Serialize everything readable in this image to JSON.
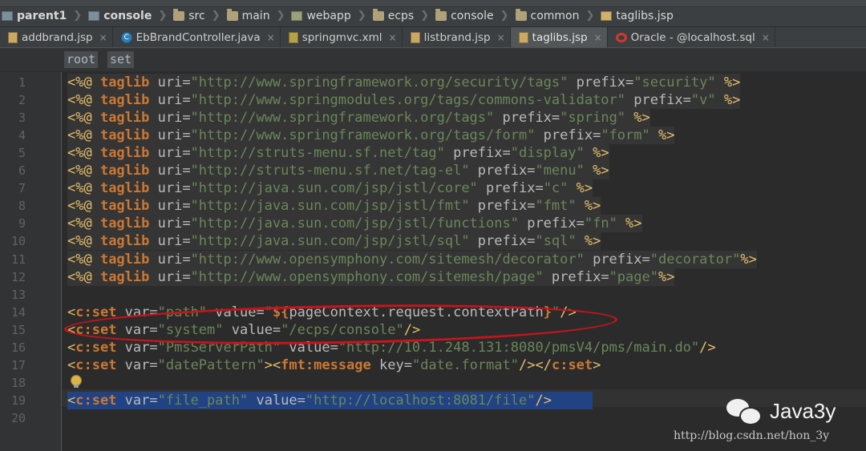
{
  "breadcrumbs": [
    {
      "label": "parent1",
      "icon": "module-icon"
    },
    {
      "label": "console",
      "icon": "module-icon"
    },
    {
      "label": "src",
      "icon": "folder-icon"
    },
    {
      "label": "main",
      "icon": "folder-icon"
    },
    {
      "label": "webapp",
      "icon": "webapp-folder-icon"
    },
    {
      "label": "ecps",
      "icon": "folder-icon"
    },
    {
      "label": "console",
      "icon": "folder-icon"
    },
    {
      "label": "common",
      "icon": "folder-icon"
    },
    {
      "label": "taglibs.jsp",
      "icon": "jsp-file-icon"
    }
  ],
  "tabs": [
    {
      "label": "addbrand.jsp",
      "icon": "jsp-file-icon",
      "close": "×"
    },
    {
      "label": "EbBrandController.java",
      "icon": "java-class-icon",
      "close": "×"
    },
    {
      "label": "springmvc.xml",
      "icon": "xml-file-icon",
      "close": "×"
    },
    {
      "label": "listbrand.jsp",
      "icon": "jsp-file-icon",
      "close": "×"
    },
    {
      "label": "taglibs.jsp",
      "icon": "jsp-file-icon",
      "close": "×",
      "active": true
    },
    {
      "label": "Oracle - @localhost.sql",
      "icon": "oracle-sql-icon",
      "close": "×"
    }
  ],
  "tag_path": [
    "root",
    "set"
  ],
  "lines": [
    {
      "num": "1",
      "tokens": [
        [
          "d",
          "<%@ "
        ],
        [
          "k",
          "taglib"
        ],
        [
          "a",
          " uri="
        ],
        [
          "v",
          "\"http://www.springframework.org/security/tags\""
        ],
        [
          "a",
          " prefix="
        ],
        [
          "v",
          "\"security\""
        ],
        [
          "d",
          " %>"
        ]
      ]
    },
    {
      "num": "2",
      "tokens": [
        [
          "d",
          "<%@ "
        ],
        [
          "k",
          "taglib"
        ],
        [
          "a",
          " uri="
        ],
        [
          "v",
          "\"http://www.springmodules.org/tags/commons-validator\""
        ],
        [
          "a",
          " prefix="
        ],
        [
          "v",
          "\"v\""
        ],
        [
          "d",
          " %>"
        ]
      ]
    },
    {
      "num": "3",
      "tokens": [
        [
          "d",
          "<%@ "
        ],
        [
          "k",
          "taglib"
        ],
        [
          "a",
          " uri="
        ],
        [
          "v",
          "\"http://www.springframework.org/tags\""
        ],
        [
          "a",
          " prefix="
        ],
        [
          "v",
          "\"spring\""
        ],
        [
          "d",
          " %>"
        ]
      ]
    },
    {
      "num": "4",
      "tokens": [
        [
          "d",
          "<%@ "
        ],
        [
          "k",
          "taglib"
        ],
        [
          "a",
          " uri="
        ],
        [
          "v",
          "\"http://www.springframework.org/tags/form\""
        ],
        [
          "a",
          " prefix="
        ],
        [
          "v",
          "\"form\""
        ],
        [
          "d",
          " %>"
        ]
      ]
    },
    {
      "num": "5",
      "tokens": [
        [
          "d",
          "<%@ "
        ],
        [
          "k",
          "taglib"
        ],
        [
          "a",
          " uri="
        ],
        [
          "v",
          "\"http://struts-menu.sf.net/tag\""
        ],
        [
          "a",
          " prefix="
        ],
        [
          "v",
          "\"display\""
        ],
        [
          "d",
          " %>"
        ]
      ]
    },
    {
      "num": "6",
      "tokens": [
        [
          "d",
          "<%@ "
        ],
        [
          "k",
          "taglib"
        ],
        [
          "a",
          " uri="
        ],
        [
          "v",
          "\"http://struts-menu.sf.net/tag-el\""
        ],
        [
          "a",
          " prefix="
        ],
        [
          "v",
          "\"menu\""
        ],
        [
          "d",
          " %>"
        ]
      ]
    },
    {
      "num": "7",
      "tokens": [
        [
          "d",
          "<%@ "
        ],
        [
          "k",
          "taglib"
        ],
        [
          "a",
          " uri="
        ],
        [
          "v",
          "\"http://java.sun.com/jsp/jstl/core\""
        ],
        [
          "a",
          " prefix="
        ],
        [
          "v",
          "\"c\""
        ],
        [
          "d",
          " %>"
        ]
      ]
    },
    {
      "num": "8",
      "tokens": [
        [
          "d",
          "<%@ "
        ],
        [
          "k",
          "taglib"
        ],
        [
          "a",
          " uri="
        ],
        [
          "v",
          "\"http://java.sun.com/jsp/jstl/fmt\""
        ],
        [
          "a",
          " prefix="
        ],
        [
          "v",
          "\"fmt\""
        ],
        [
          "d",
          " %>"
        ]
      ]
    },
    {
      "num": "9",
      "tokens": [
        [
          "d",
          "<%@ "
        ],
        [
          "k",
          "taglib"
        ],
        [
          "a",
          " uri="
        ],
        [
          "v",
          "\"http://java.sun.com/jsp/jstl/functions\""
        ],
        [
          "a",
          " prefix="
        ],
        [
          "v",
          "\"fn\""
        ],
        [
          "d",
          " %>"
        ]
      ]
    },
    {
      "num": "10",
      "tokens": [
        [
          "d",
          "<%@ "
        ],
        [
          "k",
          "taglib"
        ],
        [
          "a",
          " uri="
        ],
        [
          "v",
          "\"http://java.sun.com/jsp/jstl/sql\""
        ],
        [
          "a",
          " prefix="
        ],
        [
          "v",
          "\"sql\""
        ],
        [
          "d",
          " %>"
        ]
      ]
    },
    {
      "num": "11",
      "tokens": [
        [
          "d",
          "<%@ "
        ],
        [
          "k",
          "taglib"
        ],
        [
          "a",
          " uri="
        ],
        [
          "v",
          "\"http://www.opensymphony.com/sitemesh/decorator\""
        ],
        [
          "a",
          " prefix="
        ],
        [
          "v",
          "\"decorator\""
        ],
        [
          "d",
          "%>"
        ]
      ]
    },
    {
      "num": "12",
      "tokens": [
        [
          "d",
          "<%@ "
        ],
        [
          "k",
          "taglib"
        ],
        [
          "a",
          " uri="
        ],
        [
          "v",
          "\"http://www.opensymphony.com/sitemesh/page\""
        ],
        [
          "a",
          " prefix="
        ],
        [
          "v",
          "\"page\""
        ],
        [
          "d",
          "%>"
        ]
      ]
    },
    {
      "num": "13",
      "tokens": []
    },
    {
      "num": "14",
      "tokens": [
        [
          "t",
          "<"
        ],
        [
          "k",
          "c:set"
        ],
        [
          "a",
          " var="
        ],
        [
          "v",
          "\"path\""
        ],
        [
          "a",
          " value="
        ],
        [
          "v",
          "\""
        ],
        [
          "e",
          "${"
        ],
        [
          "a",
          "pageContext.request.contextPath"
        ],
        [
          "e",
          "}"
        ],
        [
          "v",
          "\""
        ],
        [
          "t",
          "/>"
        ]
      ]
    },
    {
      "num": "15",
      "tokens": [
        [
          "t",
          "<"
        ],
        [
          "k",
          "c:set"
        ],
        [
          "a",
          " var="
        ],
        [
          "v",
          "\"system\""
        ],
        [
          "a",
          " value="
        ],
        [
          "v",
          "\"/ecps/console\""
        ],
        [
          "t",
          "/>"
        ]
      ]
    },
    {
      "num": "16",
      "tokens": [
        [
          "t",
          "<"
        ],
        [
          "k",
          "c:set"
        ],
        [
          "a",
          " var="
        ],
        [
          "v",
          "\"PmsServerPath\""
        ],
        [
          "a",
          " value="
        ],
        [
          "v",
          "\"http://10.1.248.131:8080/pmsV4/pms/main.do\""
        ],
        [
          "t",
          "/>"
        ]
      ]
    },
    {
      "num": "17",
      "tokens": [
        [
          "t",
          "<"
        ],
        [
          "k",
          "c:set"
        ],
        [
          "a",
          " var="
        ],
        [
          "v",
          "\"datePattern\""
        ],
        [
          "t",
          "><"
        ],
        [
          "k",
          "fmt:message"
        ],
        [
          "a",
          " key="
        ],
        [
          "v",
          "\"date.format\""
        ],
        [
          "t",
          "/></"
        ],
        [
          "k",
          "c:set"
        ],
        [
          "t",
          ">"
        ]
      ]
    },
    {
      "num": "18",
      "tokens": []
    },
    {
      "num": "19",
      "tokens": [
        [
          "t",
          "<"
        ],
        [
          "k",
          "c:set"
        ],
        [
          "a",
          " var="
        ],
        [
          "v",
          "\"file_path\""
        ],
        [
          "a",
          " value="
        ],
        [
          "v",
          "\"http://localhost:8081/file\""
        ],
        [
          "t",
          "/>"
        ]
      ]
    },
    {
      "num": "20",
      "tokens": []
    }
  ],
  "watermark": {
    "brand": "Java3y",
    "url": "http://blog.csdn.net/hon_3y"
  }
}
